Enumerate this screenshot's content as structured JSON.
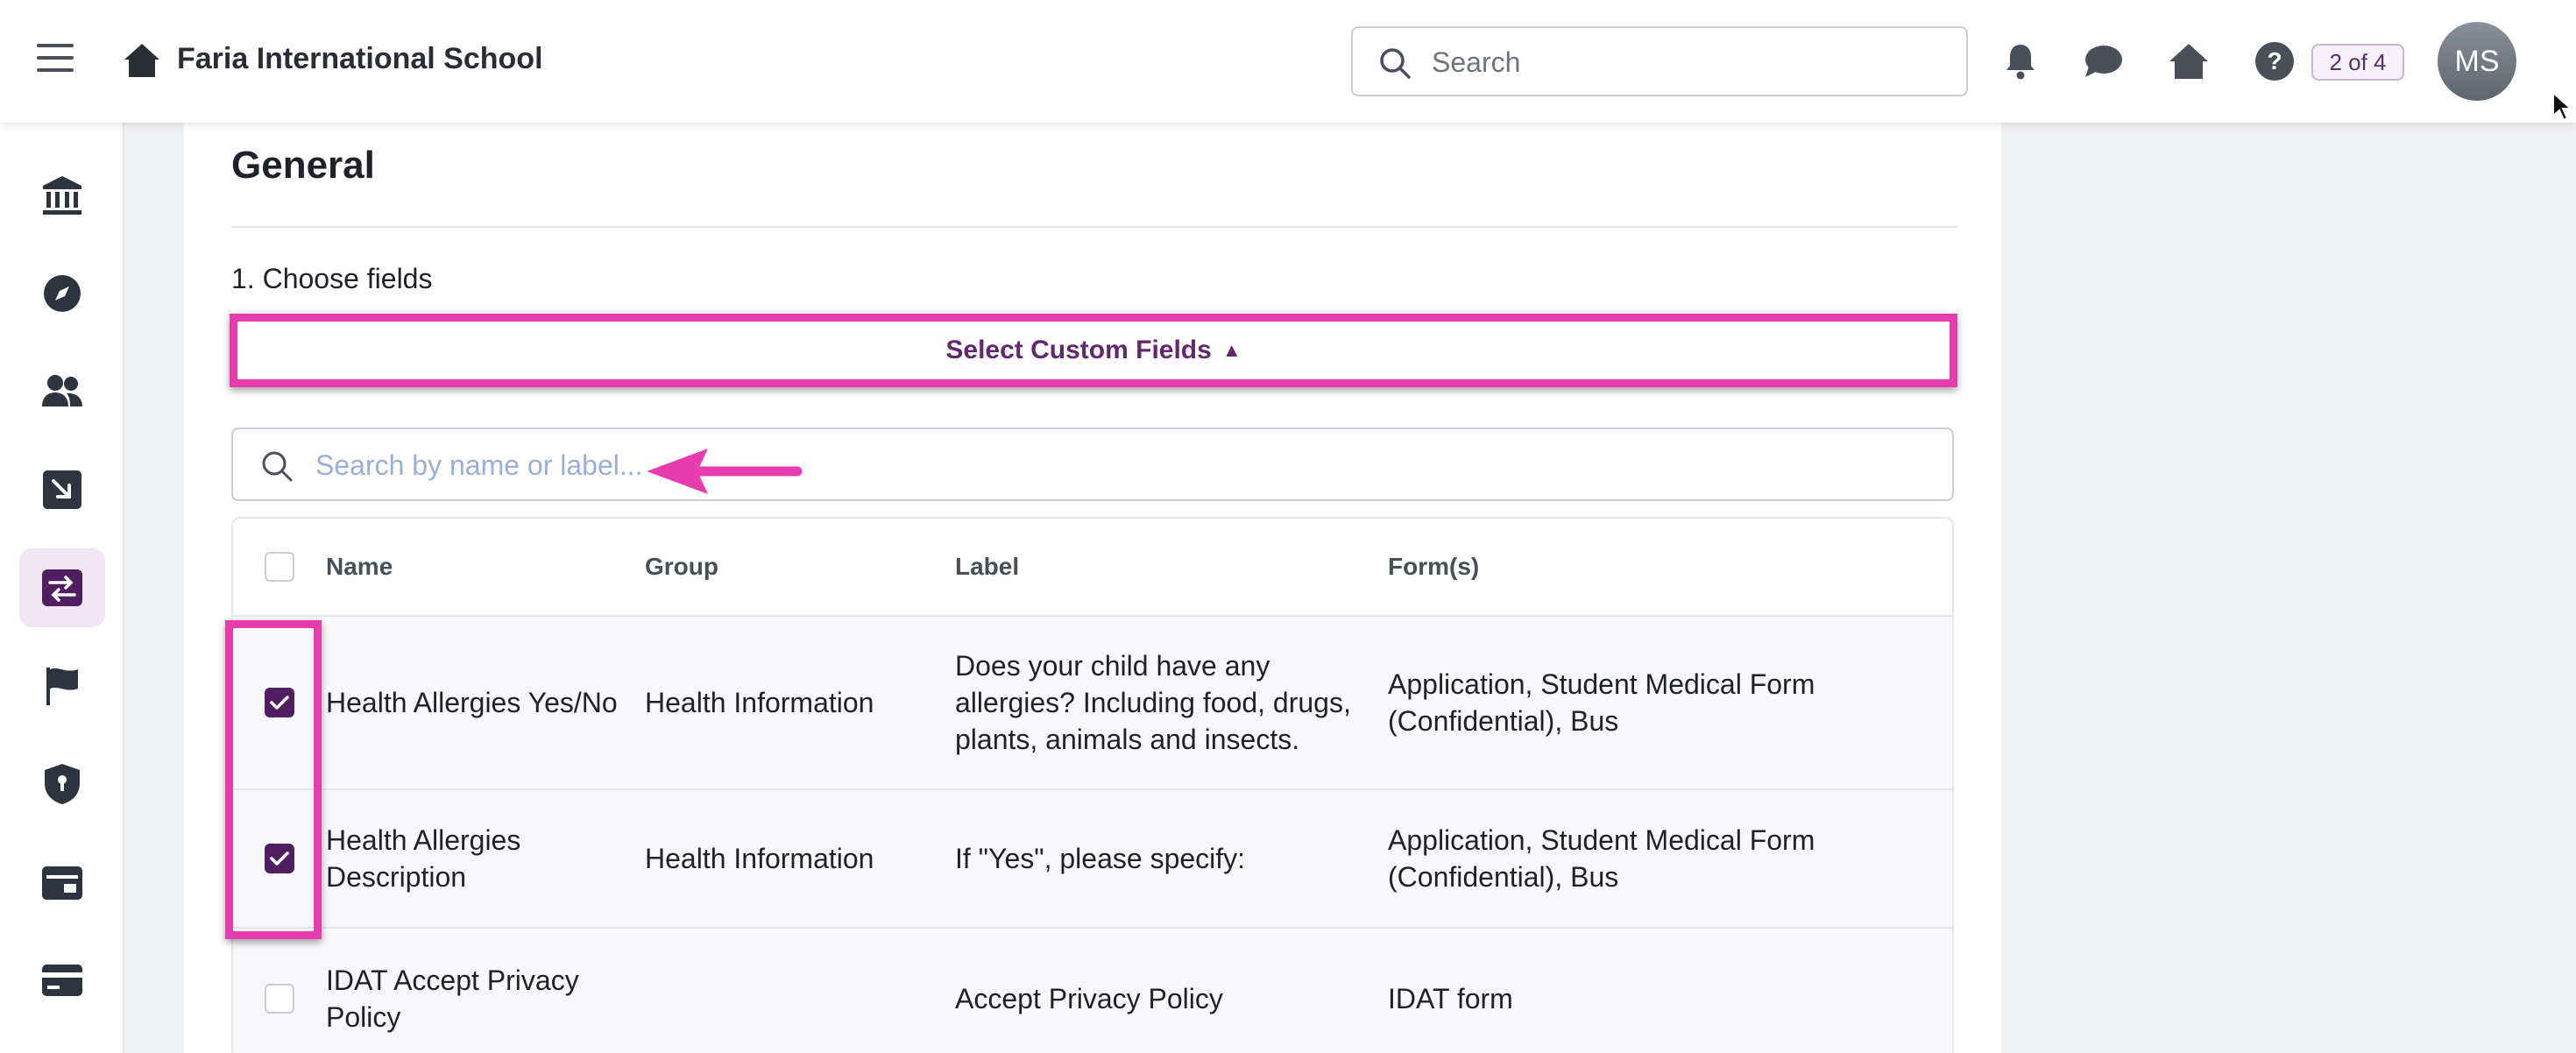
{
  "header": {
    "school_name": "Faria International School",
    "search_placeholder": "Search",
    "counter": "2 of 4",
    "avatar_initials": "MS"
  },
  "sidebar": {
    "items": [
      {
        "icon": "institution-icon",
        "active": false
      },
      {
        "icon": "compass-icon",
        "active": false
      },
      {
        "icon": "people-icon",
        "active": false
      },
      {
        "icon": "inbound-arrow-icon",
        "active": false
      },
      {
        "icon": "data-transfer-icon",
        "active": true
      },
      {
        "icon": "flag-icon",
        "active": false
      },
      {
        "icon": "shield-keyhole-icon",
        "active": false
      },
      {
        "icon": "calendar-icon",
        "active": false
      },
      {
        "icon": "card-icon",
        "active": false
      }
    ]
  },
  "main": {
    "section_title": "General",
    "step_label": "1. Choose fields",
    "select_fields_label": "Select Custom Fields",
    "field_search_placeholder": "Search by name or label...",
    "table": {
      "headers": {
        "name": "Name",
        "group": "Group",
        "label": "Label",
        "forms": "Form(s)"
      },
      "rows": [
        {
          "checked": true,
          "name": "Health Allergies Yes/No",
          "group": "Health Information",
          "label": "Does your child have any allergies? Including food, drugs, plants, animals and insects.",
          "forms": "Application, Student Medical Form (Confidential), Bus"
        },
        {
          "checked": true,
          "name": "Health Allergies Description",
          "group": "Health Information",
          "label": "If \"Yes\", please specify:",
          "forms": "Application, Student Medical Form (Confidential), Bus"
        },
        {
          "checked": false,
          "name": "IDAT Accept Privacy Policy",
          "group": "",
          "label": "Accept Privacy Policy",
          "forms": "IDAT form"
        }
      ]
    }
  },
  "colors": {
    "accent_purple": "#4f1f62",
    "annotation_pink": "#e73cad",
    "active_sidebar_bg": "#efe8f3"
  }
}
